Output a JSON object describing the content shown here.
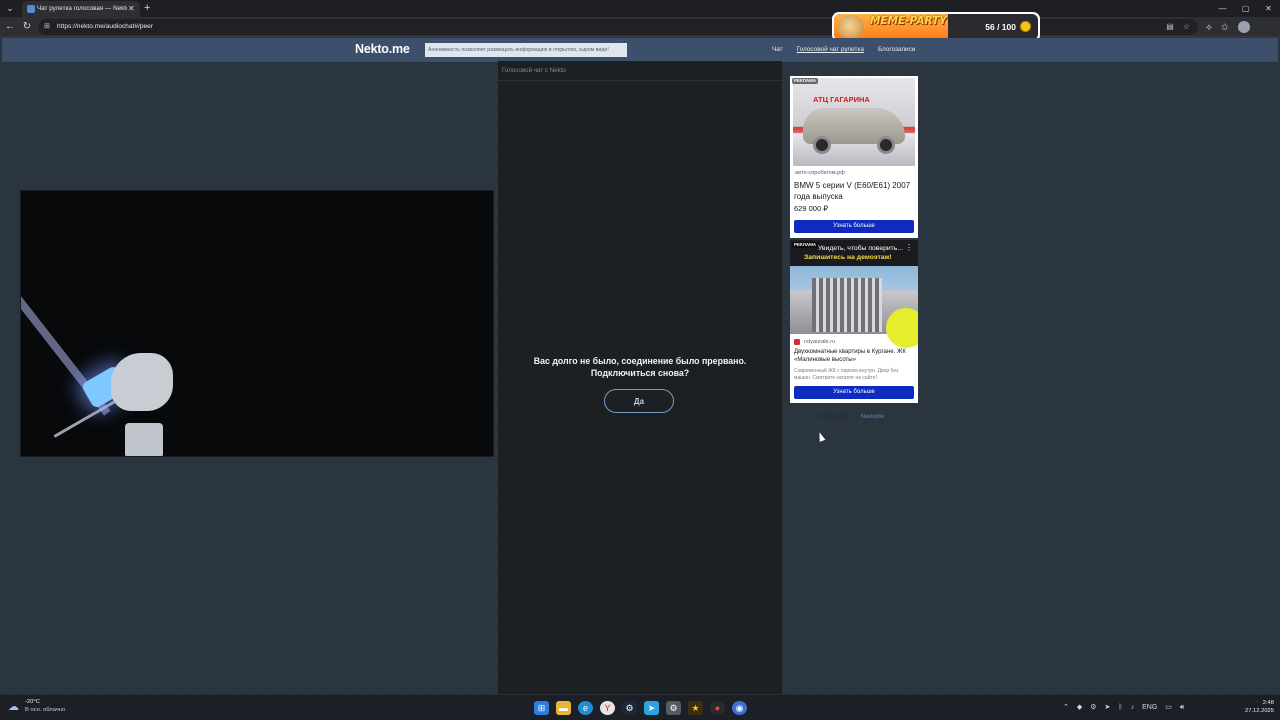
{
  "browser": {
    "tab_title": "Чат рулетка голосовая — Nekto.me",
    "tab_close": "✕",
    "new_tab": "+",
    "url": "https://nekto.me/audiochat#/peer",
    "window_controls": [
      "—",
      "▢",
      "✕"
    ],
    "nav_icons": [
      "arrow-left-icon",
      "reload-icon"
    ],
    "toolbar_icons": [
      "extensions-icon",
      "favorites-icon",
      "profile-avatar"
    ]
  },
  "meme_party": {
    "title": "MEME-PARTY",
    "score": "56 / 100",
    "progress": 0.56
  },
  "site": {
    "logo": "Nekto.me",
    "notice": "Анонимность позволяет размещать информацию в открытом, сыром виде!",
    "nav": [
      "Чат",
      "Голосовой чат рулетка",
      "Блогозаписи"
    ]
  },
  "chat": {
    "title": "Голосовой чат с Nekto",
    "message_line1": "Вас долго не было, соединение было прервано.",
    "message_line2": "Подключиться снова?",
    "button": "Да"
  },
  "ads": {
    "ad1": {
      "label": "РЕКЛАМА",
      "image_sign": "АТЦ ГАГАРИНА",
      "source": "авто-спробегом.рф",
      "title": "BMW 5 серии V (E60/E61) 2007 года выпуска",
      "price": "629 000 ₽",
      "cta": "Узнать больше"
    },
    "ad2": {
      "label": "РЕКЛАМА",
      "headline1": "Увидеть, чтобы поверить...",
      "headline2": "Запишитесь на демоэтаж!",
      "source": "rstyaurale.ru",
      "title": "Двухкомнатные квартиры в Кургане. ЖК «Малиновые высоты»",
      "description": "Современный ЖК с парком внутри. Двор без машин. Смотрите каталог на сайте!",
      "cta": "Узнать больше"
    }
  },
  "footer": {
    "copyright": "© 2011-2025",
    "link": "NektoMe"
  },
  "taskbar": {
    "temperature": "-20°C",
    "weather": "В осн. облачно",
    "language": "ENG",
    "time": "2:48",
    "date": "27.12.2025"
  }
}
